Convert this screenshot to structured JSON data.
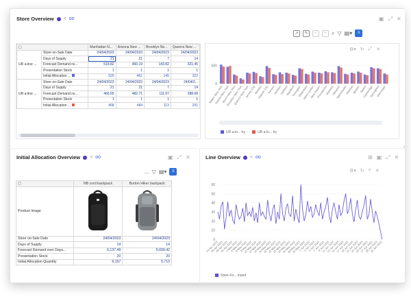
{
  "colors": {
    "accent": "#2f6fdb",
    "bar_blue": "#7b73d9",
    "bar_red": "#e07a6e",
    "line": "#5b4fd6"
  },
  "store_overview": {
    "title": "Store Overview",
    "columns": [
      "Manhattan N...",
      "Arizona New ...",
      "Brooklyn Ne...",
      "Queens New ..."
    ],
    "row_group": "UR a-line ...",
    "row_group2": "UR a-line ...",
    "row_labels": [
      "Store on-Sale Date",
      "Days of Supply",
      "Forecast Demand ov...",
      "Presentation Stock",
      "Initial Allocation ..."
    ],
    "group1": [
      [
        "24/04/2023",
        "24/04/2023",
        "24/04/2023",
        "24/04/2023"
      ],
      [
        "21",
        "21",
        "7",
        "14"
      ],
      [
        "518.82",
        "460.19",
        "143.82",
        "321.45"
      ],
      [
        "1",
        "1",
        "1",
        "1"
      ],
      [
        "520",
        "461",
        "145",
        "322"
      ]
    ],
    "group2": [
      [
        "24/04/2023",
        "24/04/2023",
        "24/04/2023",
        "24/04/2..."
      ],
      [
        "21",
        "21",
        "7",
        "14"
      ],
      [
        "466.65",
        "482.71",
        "111.97",
        "288.68"
      ],
      [
        "1",
        "1",
        "1",
        "1"
      ],
      [
        "468",
        "484",
        "113",
        "291"
      ]
    ]
  },
  "store_chart": {
    "legend": [
      "UR a-lo... try",
      "UR a-lo... try"
    ]
  },
  "initial_allocation": {
    "title": "Initial Allocation Overview",
    "products": [
      "NB cord backpack",
      "Burton Hiker backpack"
    ],
    "product_image_label": "Product Image",
    "rows": [
      {
        "label": "Store on-Sale Date",
        "values": [
          "24/04/2023",
          "24/04/2023"
        ]
      },
      {
        "label": "Days of Supply",
        "values": [
          "14",
          "14"
        ]
      },
      {
        "label": "Forecast Demand over Days...",
        "values": [
          "6,137.49",
          "5,699.42"
        ]
      },
      {
        "label": "Presentation Stock",
        "values": [
          "20",
          "20"
        ]
      },
      {
        "label": "Initial Allocation Quantity",
        "values": [
          "6,157",
          "5,710"
        ]
      }
    ],
    "dots": "..."
  },
  "line_overview": {
    "title": "Line Overview",
    "legend": "Store Fo... mand"
  },
  "chart_data": [
    {
      "type": "bar",
      "categories": [
        "Staten New York",
        "Astoria New York",
        "Bronx New York",
        "Brooklyn New York",
        "Queens New York",
        "Jersey City",
        "Newark",
        "Atlantic City",
        "Trenton",
        "Yonkers",
        "Hartford",
        "Stamford",
        "Torrington",
        "Waterbury",
        "New London",
        "New Haven",
        "Providence",
        "Warwick",
        "Newport",
        "Manchester",
        "Nashua",
        "Boston",
        "Salem",
        "Cambridge",
        "Springfield",
        "Worcester"
      ],
      "series": [
        {
          "values": [
            520,
            461,
            250,
            145,
            300,
            322,
            200,
            480,
            260,
            310,
            300,
            240,
            420,
            270,
            330,
            300,
            340,
            310,
            480,
            270,
            300,
            330,
            250,
            450,
            420,
            280
          ]
        },
        {
          "values": [
            468,
            484,
            220,
            113,
            280,
            291,
            180,
            430,
            240,
            260,
            280,
            220,
            400,
            250,
            300,
            280,
            310,
            290,
            440,
            250,
            280,
            300,
            230,
            420,
            400,
            250
          ]
        }
      ],
      "yticks": [
        0,
        500
      ],
      "ylim": [
        0,
        600
      ],
      "legend_position": "bottom-left"
    },
    {
      "type": "line",
      "series": [
        {
          "values": [
            30,
            22,
            36,
            41,
            11,
            24,
            41,
            25,
            32,
            21,
            17,
            38,
            28,
            22,
            25,
            34,
            19,
            40,
            26,
            30,
            25,
            35,
            20,
            29,
            18,
            40,
            26,
            30,
            25,
            22,
            43,
            28,
            20,
            32,
            38,
            17,
            30,
            22,
            50,
            28,
            20,
            34,
            39,
            27,
            25,
            48,
            20,
            33,
            24,
            18,
            60,
            33,
            20,
            27,
            42,
            30,
            36,
            24,
            28,
            38,
            30,
            26,
            40,
            22,
            30,
            36,
            46,
            27,
            18,
            33,
            40,
            30,
            22,
            38,
            26,
            30,
            42,
            50,
            28,
            33,
            45,
            28,
            19,
            32,
            43,
            25,
            22,
            30,
            37,
            48,
            22,
            27,
            44,
            30,
            18,
            31,
            25,
            17,
            8,
            0
          ]
        }
      ],
      "xticks": [
        "24 Apr 2023",
        "26 Apr 2023",
        "28 Apr 2023",
        "30 Apr 2023",
        "2 May 2023",
        "4 May 2023",
        "6 May 2023",
        "8 May 2023",
        "10 May 2023",
        "12 May 2023",
        "14 May 2023",
        "16 May 2023",
        "18 May 2023",
        "20 May 2023",
        "22 May 2023",
        "24 May 2023",
        "26 May 2023",
        "28 May 2023",
        "30 May 2023",
        "1 Jun 2023",
        "3 Jun 2023",
        "5 Jun 2023",
        "7 Jun 2023",
        "9 Jun 2023",
        "11 Jun 2023",
        "13 Jun 2023",
        "15 Jun 2023",
        "17 Jun 2023",
        "19 Jun 2023",
        "21 Jun 2023",
        "23 Jun 2023",
        "25 Jun 2023",
        "27 Jun 2023",
        "29 Jun 2023",
        "30 Jun 2023"
      ],
      "yticks": [
        0,
        10,
        20,
        30,
        40,
        50,
        60
      ],
      "ylim": [
        0,
        60
      ],
      "legend_position": "bottom-left"
    }
  ]
}
